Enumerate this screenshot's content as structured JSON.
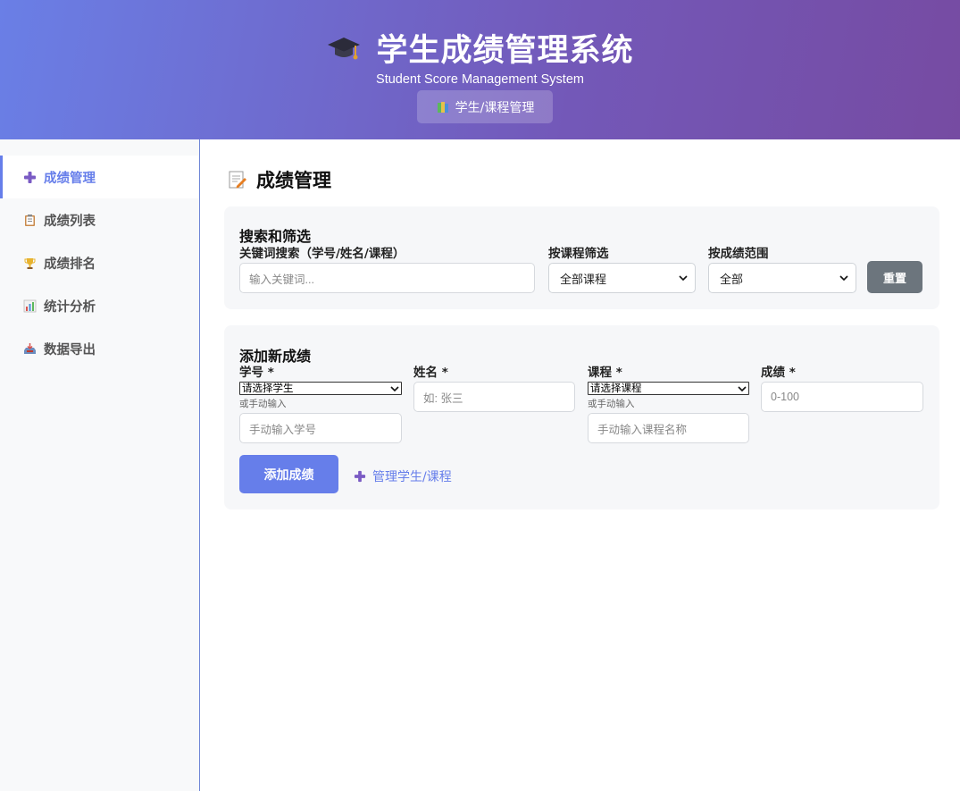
{
  "header": {
    "title": "学生成绩管理系统",
    "subtitle": "Student Score Management System",
    "manage_button": "学生/课程管理"
  },
  "sidebar": {
    "items": [
      {
        "label": "成绩管理",
        "icon": "plus-icon",
        "active": true
      },
      {
        "label": "成绩列表",
        "icon": "clipboard-icon",
        "active": false
      },
      {
        "label": "成绩排名",
        "icon": "trophy-icon",
        "active": false
      },
      {
        "label": "统计分析",
        "icon": "bar-chart-icon",
        "active": false
      },
      {
        "label": "数据导出",
        "icon": "inbox-tray-icon",
        "active": false
      }
    ]
  },
  "main": {
    "page_title": "成绩管理",
    "search": {
      "title": "搜索和筛选",
      "keyword_label": "关键词搜索（学号/姓名/课程）",
      "keyword_placeholder": "输入关键词...",
      "course_filter_label": "按课程筛选",
      "course_filter_value": "全部课程",
      "score_range_label": "按成绩范围",
      "score_range_value": "全部",
      "reset_button": "重置"
    },
    "add": {
      "title": "添加新成绩",
      "student_id_label": "学号 *",
      "student_select_value": "请选择学生",
      "student_hint": "或手动输入",
      "student_id_placeholder": "手动输入学号",
      "name_label": "姓名 *",
      "name_placeholder": "如: 张三",
      "course_label": "课程 *",
      "course_select_value": "请选择课程",
      "course_hint": "或手动输入",
      "course_placeholder": "手动输入课程名称",
      "score_label": "成绩 *",
      "score_placeholder": "0-100",
      "add_button": "添加成绩",
      "manage_link": "管理学生/课程"
    }
  },
  "colors": {
    "accent": "#667eea",
    "header_start": "#6a7fe6",
    "header_end": "#764ba2",
    "reset_button": "#6c757d"
  }
}
